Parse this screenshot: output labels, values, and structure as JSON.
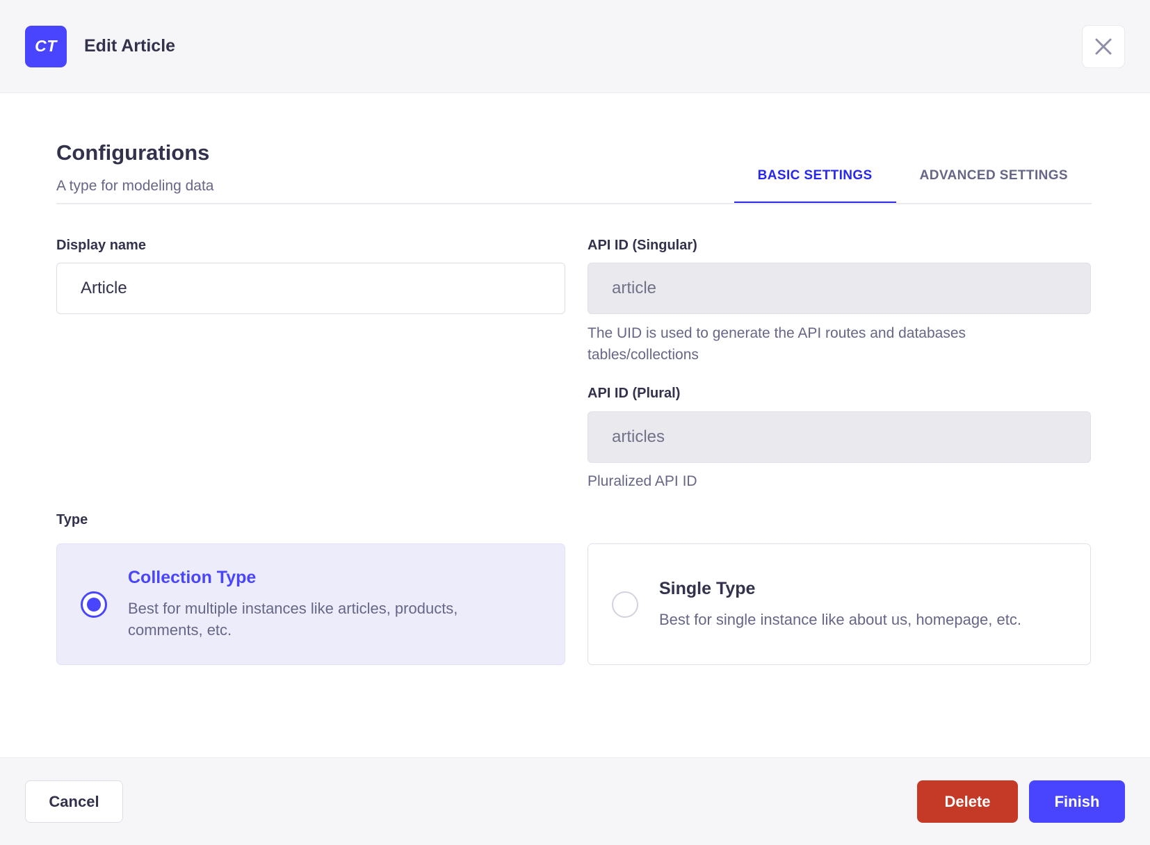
{
  "header": {
    "badge": "CT",
    "title": "Edit Article"
  },
  "configurations": {
    "title": "Configurations",
    "subtitle": "A type for modeling data"
  },
  "tabs": [
    {
      "label": "BASIC SETTINGS",
      "active": true
    },
    {
      "label": "ADVANCED SETTINGS",
      "active": false
    }
  ],
  "form": {
    "display_name": {
      "label": "Display name",
      "value": "Article"
    },
    "api_id_singular": {
      "label": "API ID (Singular)",
      "value": "article",
      "help": "The UID is used to generate the API routes and databases tables/collections"
    },
    "api_id_plural": {
      "label": "API ID (Plural)",
      "value": "articles",
      "help": "Pluralized API ID"
    },
    "type": {
      "label": "Type",
      "options": [
        {
          "title": "Collection Type",
          "description": "Best for multiple instances like articles, products, comments, etc.",
          "selected": true
        },
        {
          "title": "Single Type",
          "description": "Best for single instance like about us, homepage, etc.",
          "selected": false
        }
      ]
    }
  },
  "footer": {
    "cancel_label": "Cancel",
    "delete_label": "Delete",
    "finish_label": "Finish"
  },
  "colors": {
    "primary": "#4945ff",
    "tab_active": "#2727ef",
    "danger": "#c43a26",
    "selected_card_bg": "#edecfb",
    "header_bg": "#f6f6f9",
    "text_dark": "#32324d",
    "text_muted": "#666687"
  }
}
